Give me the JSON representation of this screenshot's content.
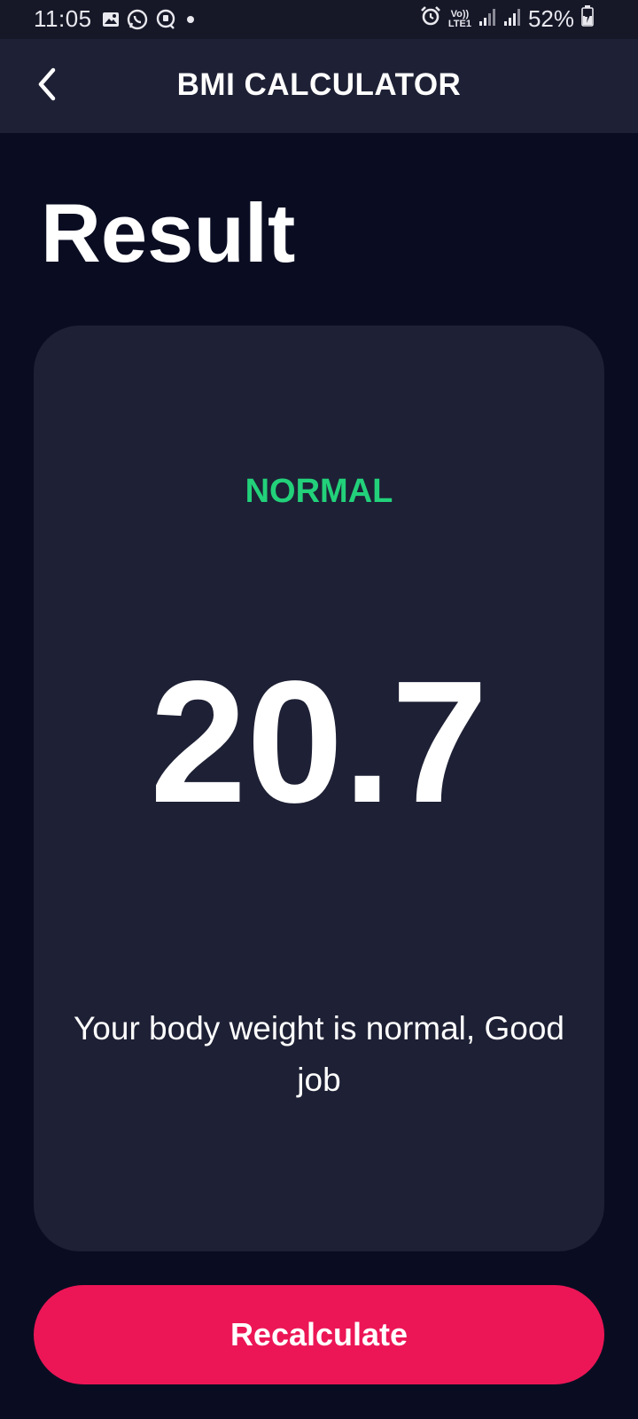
{
  "status_bar": {
    "time": "11:05",
    "battery_percent": "52%",
    "network_top": "Vo))",
    "network_bottom": "LTE1",
    "icons": [
      "gallery-icon",
      "whatsapp-icon",
      "chat-icon",
      "dot-icon",
      "alarm-icon",
      "signal-icon",
      "signal-icon",
      "battery-charging-icon"
    ]
  },
  "app_bar": {
    "title": "BMI CALCULATOR",
    "back_icon": "chevron-left-icon"
  },
  "page": {
    "heading": "Result"
  },
  "result": {
    "status": "NORMAL",
    "bmi": "20.7",
    "message": "Your body weight is normal, Good job"
  },
  "actions": {
    "recalculate_label": "Recalculate"
  },
  "colors": {
    "background": "#0a0d22",
    "card": "#1e2035",
    "status_normal": "#22d17a",
    "accent": "#ec1656"
  }
}
